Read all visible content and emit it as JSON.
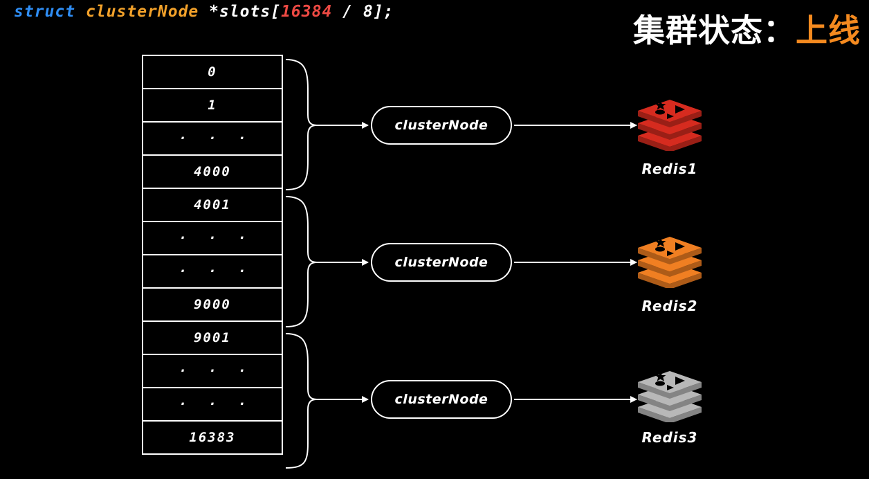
{
  "code": {
    "keyword": "struct",
    "type": "clusterNode",
    "var_prefix": " *slots[",
    "number": "16384",
    "var_suffix": " / 8];"
  },
  "status": {
    "label": "集群状态：",
    "value": "上线"
  },
  "slots": [
    {
      "text": "0",
      "dots": false
    },
    {
      "text": "1",
      "dots": false
    },
    {
      "text": "...",
      "dots": true
    },
    {
      "text": "4000",
      "dots": false
    },
    {
      "text": "4001",
      "dots": false
    },
    {
      "text": "...",
      "dots": true
    },
    {
      "text": "...",
      "dots": true
    },
    {
      "text": "9000",
      "dots": false
    },
    {
      "text": "9001",
      "dots": false
    },
    {
      "text": "...",
      "dots": true
    },
    {
      "text": "...",
      "dots": true
    },
    {
      "text": "16383",
      "dots": false
    }
  ],
  "nodes": [
    {
      "label": "clusterNode",
      "redis": "Redis1",
      "color": "#d62b1f"
    },
    {
      "label": "clusterNode",
      "redis": "Redis2",
      "color": "#f07f22"
    },
    {
      "label": "clusterNode",
      "redis": "Redis3",
      "color": "#b8b8b8"
    }
  ],
  "colors": {
    "struct": "#2f8ef5",
    "type": "#f2a12a",
    "number": "#ee4a44",
    "status_value": "#f58a1f"
  }
}
